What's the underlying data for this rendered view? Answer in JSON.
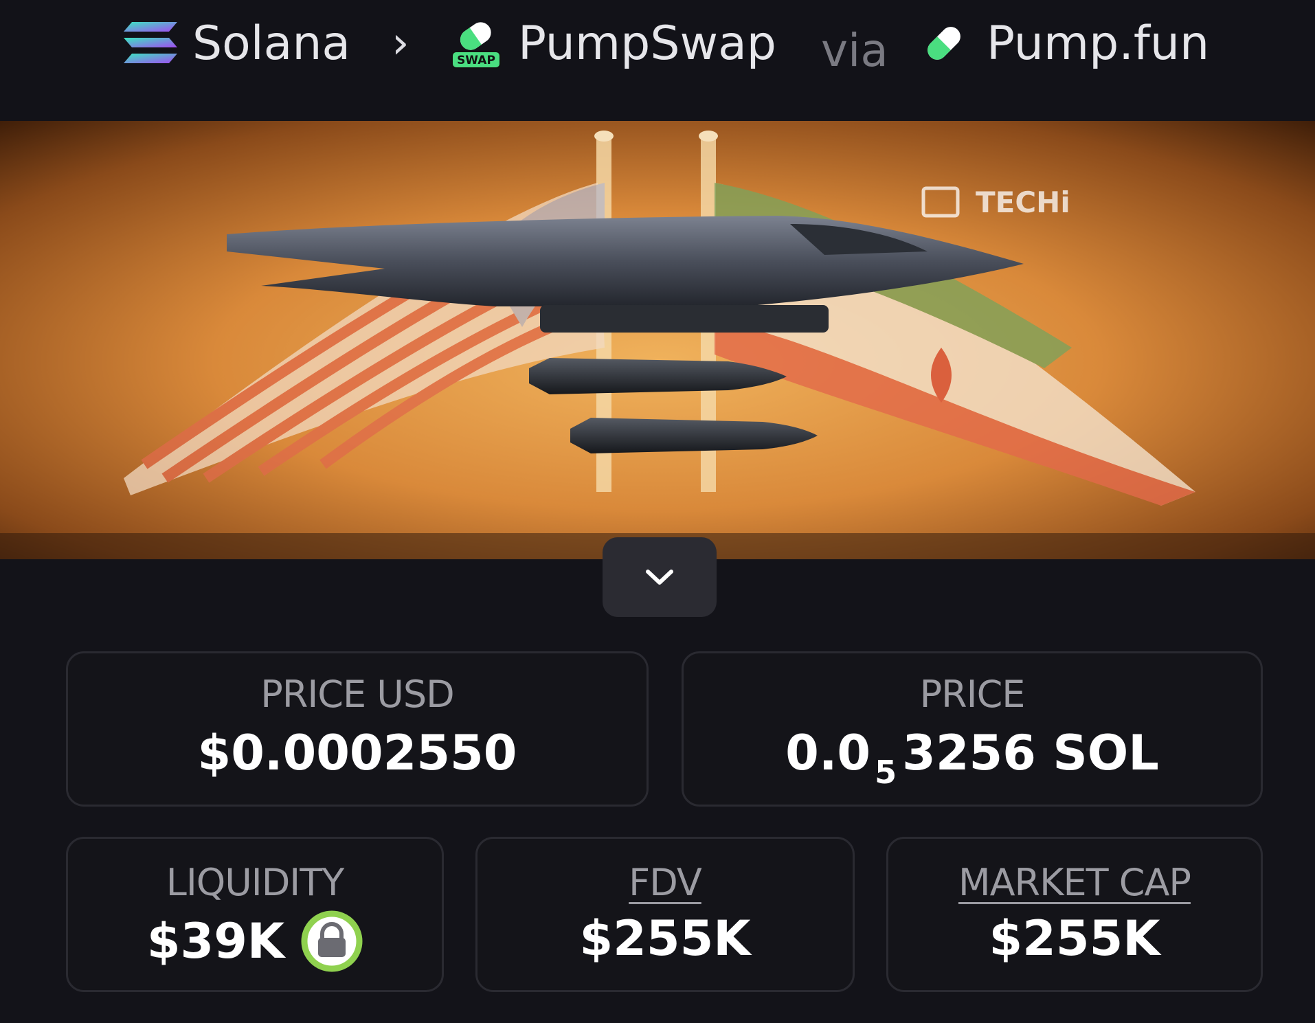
{
  "breadcrumb": {
    "chain": {
      "label": "Solana",
      "icon": "solana-logo-icon"
    },
    "separator": "›",
    "dex": {
      "label": "PumpSwap",
      "icon": "pumpswap-logo-icon",
      "icon_badge": "SWAP"
    },
    "via_label": "via",
    "launchpad": {
      "label": "Pump.fun",
      "icon": "pumpfun-pill-icon"
    }
  },
  "banner": {
    "watermark": "TECHi",
    "alt": "token banner image",
    "expand_icon": "chevron-down-icon"
  },
  "stats": {
    "price_usd": {
      "label": "PRICE USD",
      "value": "$0.0002550"
    },
    "price_native": {
      "label": "PRICE",
      "value_prefix": "0.0",
      "value_subscript": "5",
      "value_suffix": "3256 SOL"
    },
    "liquidity": {
      "label": "LIQUIDITY",
      "value": "$39K",
      "icon": "lock-icon"
    },
    "fdv": {
      "label": "FDV",
      "value": "$255K"
    },
    "market_cap": {
      "label": "MARKET CAP",
      "value": "$255K"
    }
  },
  "colors": {
    "background": "#131319",
    "card_border": "#2a2a31",
    "label_gray": "#9c9ca3",
    "lock_green": "#8fd14f",
    "pump_green": "#4ade80"
  }
}
